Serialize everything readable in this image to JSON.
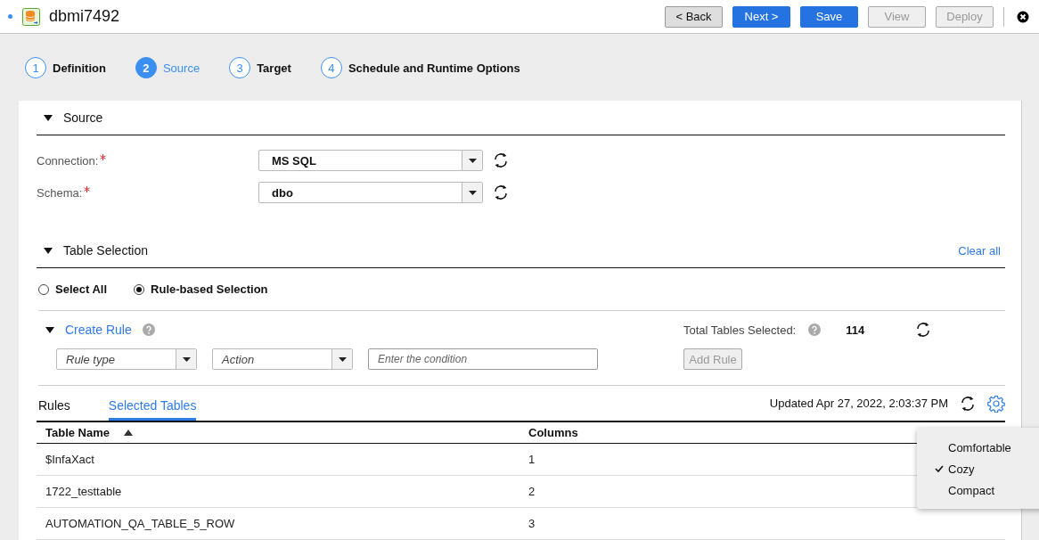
{
  "header": {
    "title": "dbmi7492",
    "buttons": [
      {
        "label": "< Back",
        "kind": "secondary",
        "disabled": false
      },
      {
        "label": "Next >",
        "kind": "primary",
        "disabled": false
      },
      {
        "label": "Save",
        "kind": "primary",
        "disabled": false
      },
      {
        "label": "View",
        "kind": "secondary",
        "disabled": true
      },
      {
        "label": "Deploy",
        "kind": "secondary",
        "disabled": true
      }
    ]
  },
  "steps": [
    {
      "number": "1",
      "label": "Definition",
      "selected": false
    },
    {
      "number": "2",
      "label": "Source",
      "selected": true
    },
    {
      "number": "3",
      "label": "Target",
      "selected": false
    },
    {
      "number": "4",
      "label": "Schedule and Runtime Options",
      "selected": false
    }
  ],
  "source": {
    "title": "Source",
    "expanded": true,
    "fields": [
      {
        "label": "Connection:",
        "required": true,
        "value": "MS SQL"
      },
      {
        "label": "Schema:",
        "required": true,
        "value": "dbo"
      }
    ]
  },
  "table_selection": {
    "title": "Table Selection",
    "expanded": true,
    "clear_link": "Clear all",
    "options": [
      {
        "label": "Select All",
        "selected": false
      },
      {
        "label": "Rule-based Selection",
        "selected": true
      }
    ]
  },
  "create_rule": {
    "title": "Create Rule",
    "expanded": true,
    "rule_type": {
      "placeholder": "Rule type"
    },
    "action": {
      "placeholder": "Action"
    },
    "condition": {
      "placeholder": "Enter the condition"
    },
    "add_button": {
      "label": "Add Rule",
      "disabled": true
    },
    "total_label": "Total Tables Selected:",
    "total_value": "114"
  },
  "tabs": [
    {
      "label": "Rules",
      "selected": false
    },
    {
      "label": "Selected Tables",
      "selected": true
    }
  ],
  "updated": "Updated Apr 27, 2022, 2:03:37 PM",
  "table": {
    "columns": [
      {
        "label": "Table Name",
        "sorted": true
      },
      {
        "label": "Columns",
        "sorted": false
      }
    ],
    "rows": [
      [
        "$InfaXact",
        "1"
      ],
      [
        "1722_testtable",
        "2"
      ],
      [
        "AUTOMATION_QA_TABLE_5_ROW",
        "3"
      ]
    ]
  },
  "density_menu": [
    {
      "label": "Comfortable",
      "checked": false
    },
    {
      "label": "Cozy",
      "checked": true
    },
    {
      "label": "Compact",
      "checked": false
    }
  ]
}
